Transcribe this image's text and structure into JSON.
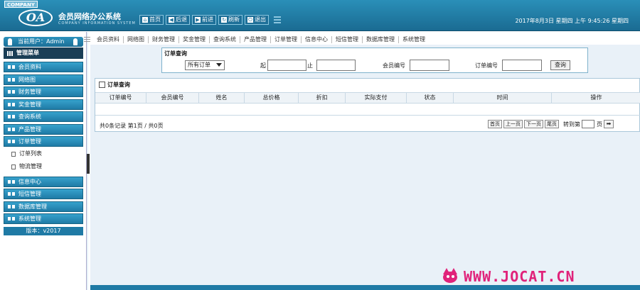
{
  "header": {
    "company_tag": "COMPANY",
    "logo_mark": "OA",
    "title": "会员网络办公系统",
    "subtitle": "COMPANY INFORMATION SYSTEM",
    "toolbar": [
      {
        "label": "首页",
        "icon": "home-icon",
        "glyph": "⌂"
      },
      {
        "label": "后退",
        "icon": "back-arrow-icon",
        "glyph": "◀"
      },
      {
        "label": "前进",
        "icon": "forward-arrow-icon",
        "glyph": "▶"
      },
      {
        "label": "刷新",
        "icon": "refresh-icon",
        "glyph": "↻"
      },
      {
        "label": "退出",
        "icon": "power-icon",
        "glyph": "⏻"
      }
    ],
    "datetime": "2017年8月3日  星期四  上午  9:45:26 星期四"
  },
  "sidebar": {
    "user_label": "当前用户：Admin",
    "menu_title": "管理菜单",
    "items": [
      {
        "label": "会员资料"
      },
      {
        "label": "网络图"
      },
      {
        "label": "财务管理"
      },
      {
        "label": "奖金管理"
      },
      {
        "label": "查询系统"
      },
      {
        "label": "产品管理"
      },
      {
        "label": "订单管理"
      }
    ],
    "sub_items": [
      {
        "label": "订单列表"
      },
      {
        "label": "物流管理"
      }
    ],
    "items_after": [
      {
        "label": "信息中心"
      },
      {
        "label": "短信管理"
      },
      {
        "label": "数据库管理"
      },
      {
        "label": "系统管理"
      }
    ],
    "version": "版本：v2017"
  },
  "topnav": [
    "会员资料",
    "网络图",
    "财务管理",
    "奖金管理",
    "查询系统",
    "产品管理",
    "订单管理",
    "信息中心",
    "短信管理",
    "数据库管理",
    "系统管理"
  ],
  "query": {
    "title": "订单查询",
    "select_value": "所有订单",
    "from_label": "起",
    "to_label": "止",
    "member_label": "会员编号",
    "order_label": "订单编号",
    "button": "查询"
  },
  "list": {
    "title": "订单查询",
    "columns": [
      "订单编号",
      "会员编号",
      "姓名",
      "总价格",
      "折扣",
      "实际支付",
      "状态",
      "时间",
      "操作"
    ],
    "summary": "共0条记录  第1页 / 共0页",
    "pager": {
      "first": "首页",
      "prev": "上一页",
      "next": "下一页",
      "last": "尾页",
      "goto_label": "转到第",
      "page_unit": "页",
      "go": "➡"
    }
  },
  "watermark": "WWW.JOCAT.CN",
  "colors": {
    "header": "#1a6b92",
    "nav_item": "#2b8bb8",
    "watermark": "#e0227a"
  }
}
